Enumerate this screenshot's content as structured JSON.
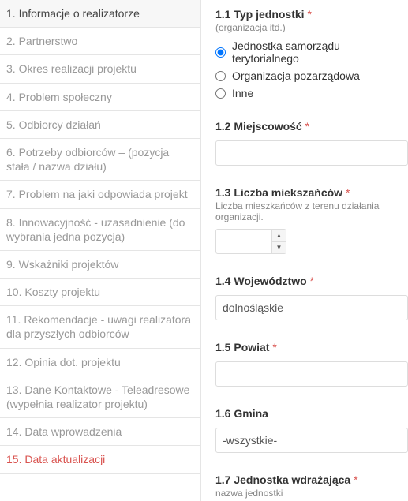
{
  "sidebar": {
    "items": [
      {
        "label": "1. Informacje o realizatorze",
        "state": "active"
      },
      {
        "label": "2. Partnerstwo",
        "state": ""
      },
      {
        "label": "3. Okres realizacji projektu",
        "state": ""
      },
      {
        "label": "4. Problem społeczny",
        "state": ""
      },
      {
        "label": "5. Odbiorcy działań",
        "state": ""
      },
      {
        "label": "6. Potrzeby odbiorców – (pozycja stała / nazwa działu)",
        "state": ""
      },
      {
        "label": "7. Problem na jaki odpowiada projekt",
        "state": ""
      },
      {
        "label": "8. Innowacyjność - uzasadnienie (do wybrania jedna pozycja)",
        "state": ""
      },
      {
        "label": "9. Wskażniki projektów",
        "state": ""
      },
      {
        "label": "10. Koszty projektu",
        "state": ""
      },
      {
        "label": "11. Rekomendacje - uwagi realizatora dla przyszłych odbiorców",
        "state": ""
      },
      {
        "label": "12. Opinia dot. projektu",
        "state": ""
      },
      {
        "label": "13. Dane Kontaktowe - Teleadresowe (wypełnia realizator projektu)",
        "state": ""
      },
      {
        "label": "14. Data wprowadzenia",
        "state": ""
      },
      {
        "label": "15. Data aktualizacji",
        "state": "highlight"
      }
    ]
  },
  "form": {
    "f1_1": {
      "label": "1.1 Typ jednostki",
      "sub": "(organizacja itd.)",
      "required": "*",
      "options": [
        {
          "label": "Jednostka samorządu terytorialnego",
          "checked": true
        },
        {
          "label": "Organizacja pozarządowa",
          "checked": false
        },
        {
          "label": "Inne",
          "checked": false
        }
      ]
    },
    "f1_2": {
      "label": "1.2 Miejscowość",
      "required": "*",
      "value": ""
    },
    "f1_3": {
      "label": "1.3 Liczba miekszańców",
      "required": "*",
      "sub": "Liczba mieszkańców z terenu działania organizacji.",
      "value": ""
    },
    "f1_4": {
      "label": "1.4 Województwo",
      "required": "*",
      "value": "dolnośląskie"
    },
    "f1_5": {
      "label": "1.5 Powiat",
      "required": "*",
      "value": ""
    },
    "f1_6": {
      "label": "1.6 Gmina",
      "value": "-wszystkie-"
    },
    "f1_7": {
      "label": "1.7 Jednostka wdrażająca",
      "required": "*",
      "sub": "nazwa jednostki"
    }
  }
}
